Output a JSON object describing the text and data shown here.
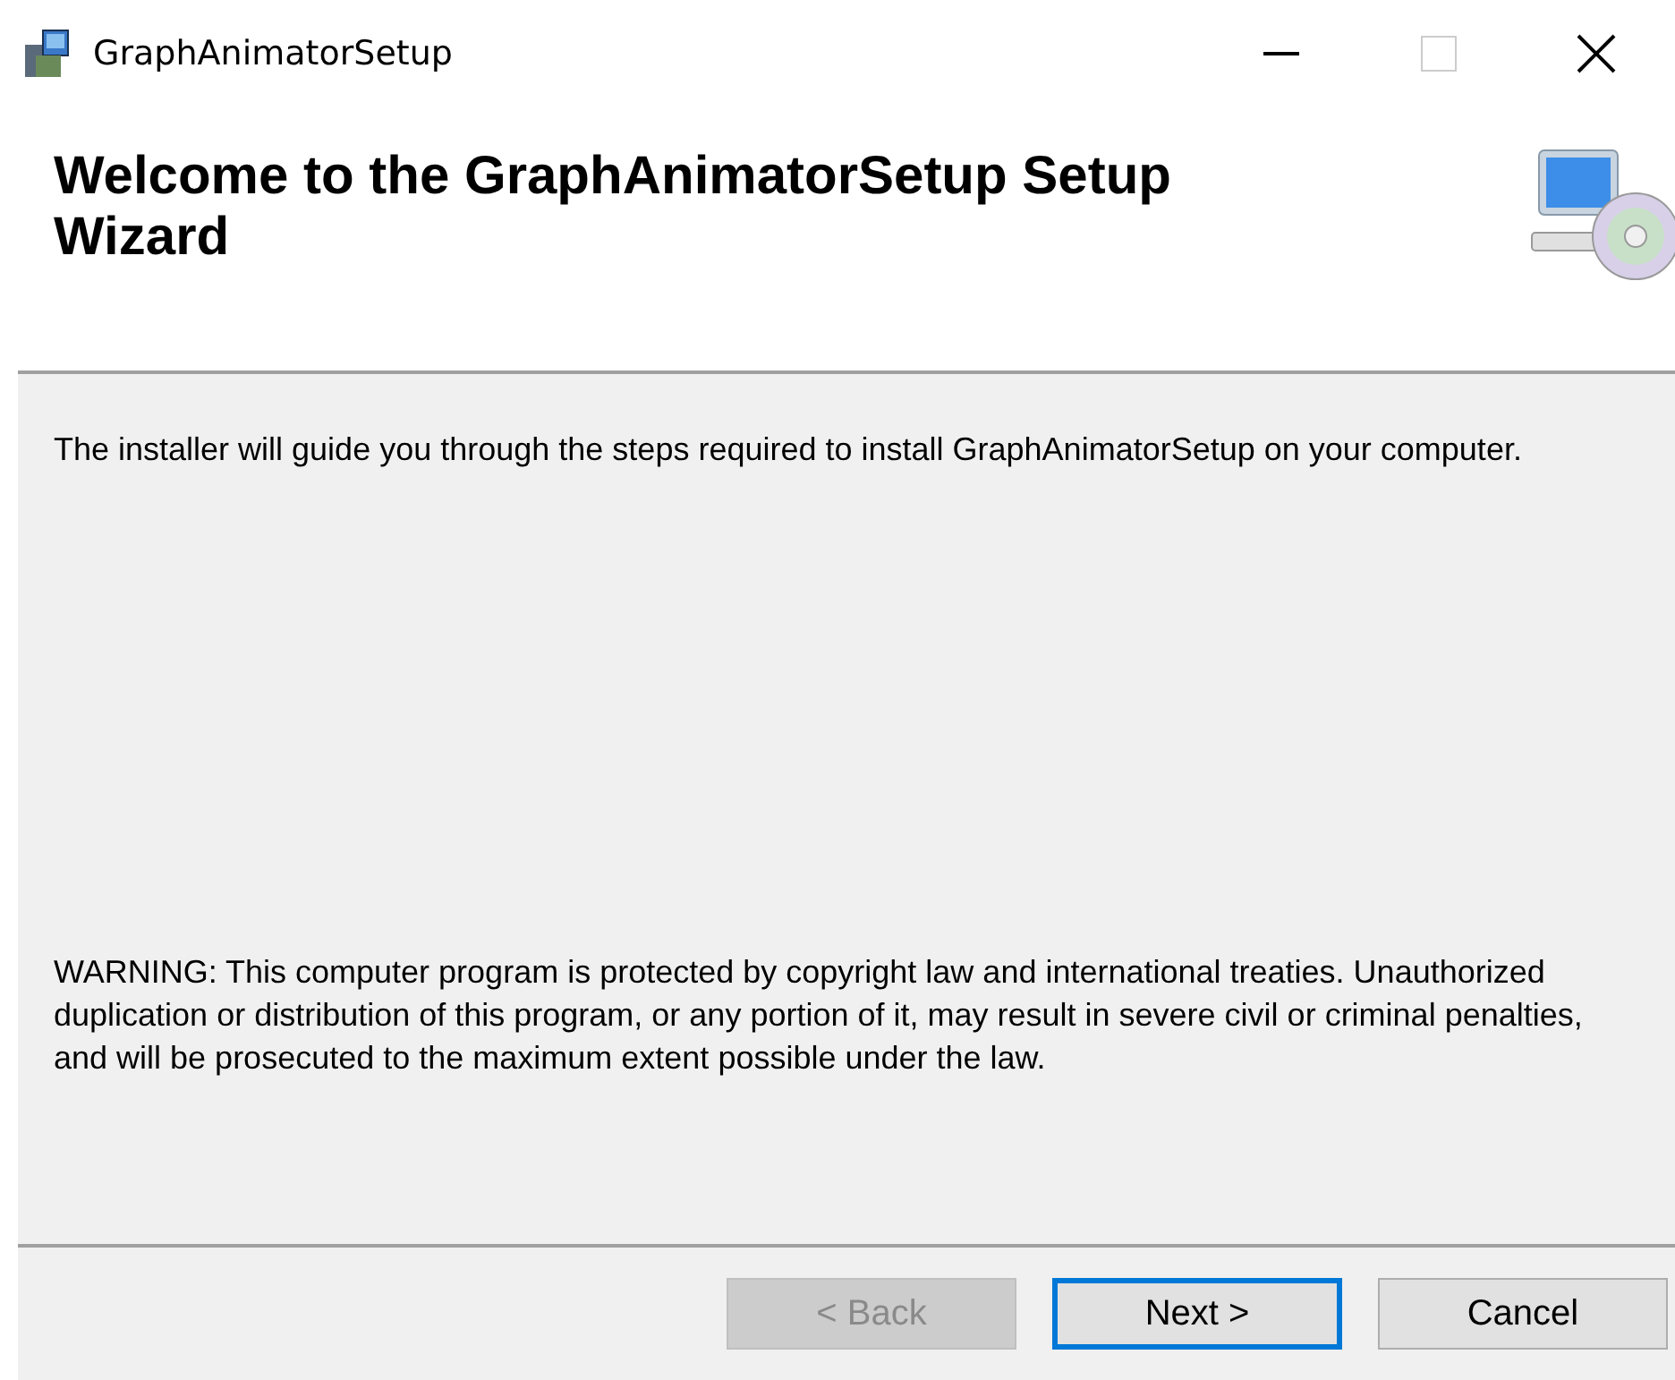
{
  "window": {
    "title": "GraphAnimatorSetup"
  },
  "header": {
    "title": "Welcome to the GraphAnimatorSetup Setup Wizard"
  },
  "body": {
    "intro": "The installer will guide you through the steps required to install GraphAnimatorSetup on your computer.",
    "warning": "WARNING: This computer program is protected by copyright law and international treaties. Unauthorized duplication or distribution of this program, or any portion of it, may result in severe civil or criminal penalties, and will be prosecuted to the maximum extent possible under the law."
  },
  "buttons": [
    {
      "label": "< Back",
      "disabled": true,
      "default": false
    },
    {
      "label": "Next >",
      "disabled": false,
      "default": true
    },
    {
      "label": "Cancel",
      "disabled": false,
      "default": false
    }
  ]
}
